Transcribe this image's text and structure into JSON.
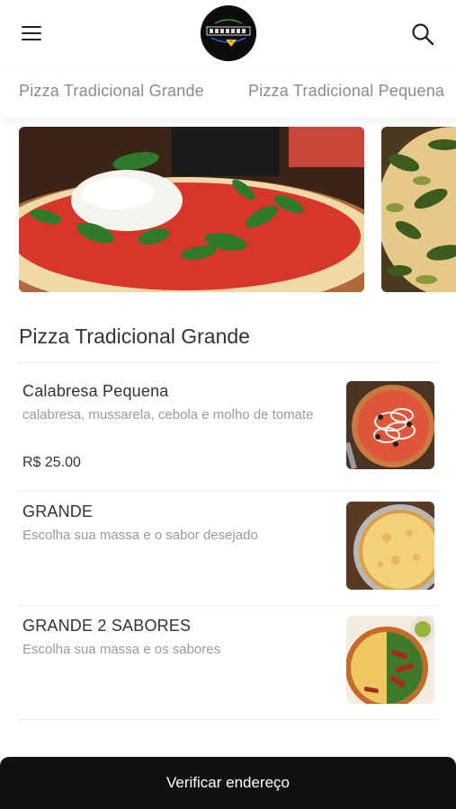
{
  "header": {
    "menu_icon": "hamburger-menu-icon",
    "logo_icon": "restaurant-logo",
    "search_icon": "search-icon"
  },
  "tabs": [
    {
      "label": "Pizza Tradicional Grande"
    },
    {
      "label": "Pizza Tradicional Pequena"
    }
  ],
  "banners": [
    {
      "image": "burrata-pizza-photo"
    },
    {
      "image": "vegetable-pizza-photo"
    }
  ],
  "section": {
    "title": "Pizza Tradicional Grande"
  },
  "items": [
    {
      "name": "Calabresa Pequena",
      "description": "calabresa, mussarela, cebola e molho de tomate",
      "price": "R$ 25.00",
      "image": "calabresa-pizza-photo"
    },
    {
      "name": "GRANDE",
      "description": "Escolha sua massa e o sabor desejado",
      "price": "",
      "image": "cheese-pizza-photo"
    },
    {
      "name": "GRANDE 2 SABORES",
      "description": "Escolha sua massa e os sabores",
      "price": "",
      "image": "two-flavor-pizza-photo"
    }
  ],
  "bottom_button": {
    "label": "Verificar endereço"
  },
  "colors": {
    "bottom_bar": "#111111",
    "tab_text": "#8a8a8a",
    "description_text": "#9a9a9a"
  }
}
